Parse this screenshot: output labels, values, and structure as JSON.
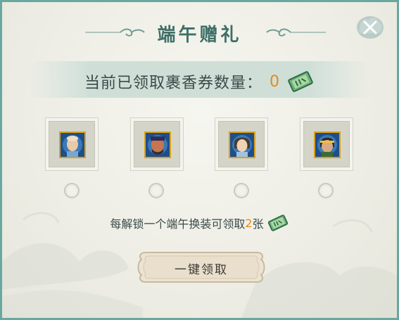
{
  "dialog": {
    "title": "端午赠礼",
    "close_icon": "close-icon"
  },
  "count": {
    "label": "当前已领取裹香券数量：",
    "value": "0",
    "icon": "ticket-icon"
  },
  "slots": [
    {
      "portrait": "character-portrait-bald-monk",
      "selected": false
    },
    {
      "portrait": "character-portrait-red-warrior",
      "selected": false
    },
    {
      "portrait": "character-portrait-young-girl",
      "selected": false
    },
    {
      "portrait": "character-portrait-headband-hero",
      "selected": false
    }
  ],
  "unlock": {
    "text_before": "每解锁一个端午换装可领取",
    "num": "2",
    "text_after": "张",
    "icon": "ticket-icon"
  },
  "claim_button": {
    "label": "一键领取"
  },
  "colors": {
    "frame": "#6aa79e",
    "title": "#3f6f67",
    "accent_orange": "#e58a1a",
    "ticket_green": "#5fa36e"
  }
}
